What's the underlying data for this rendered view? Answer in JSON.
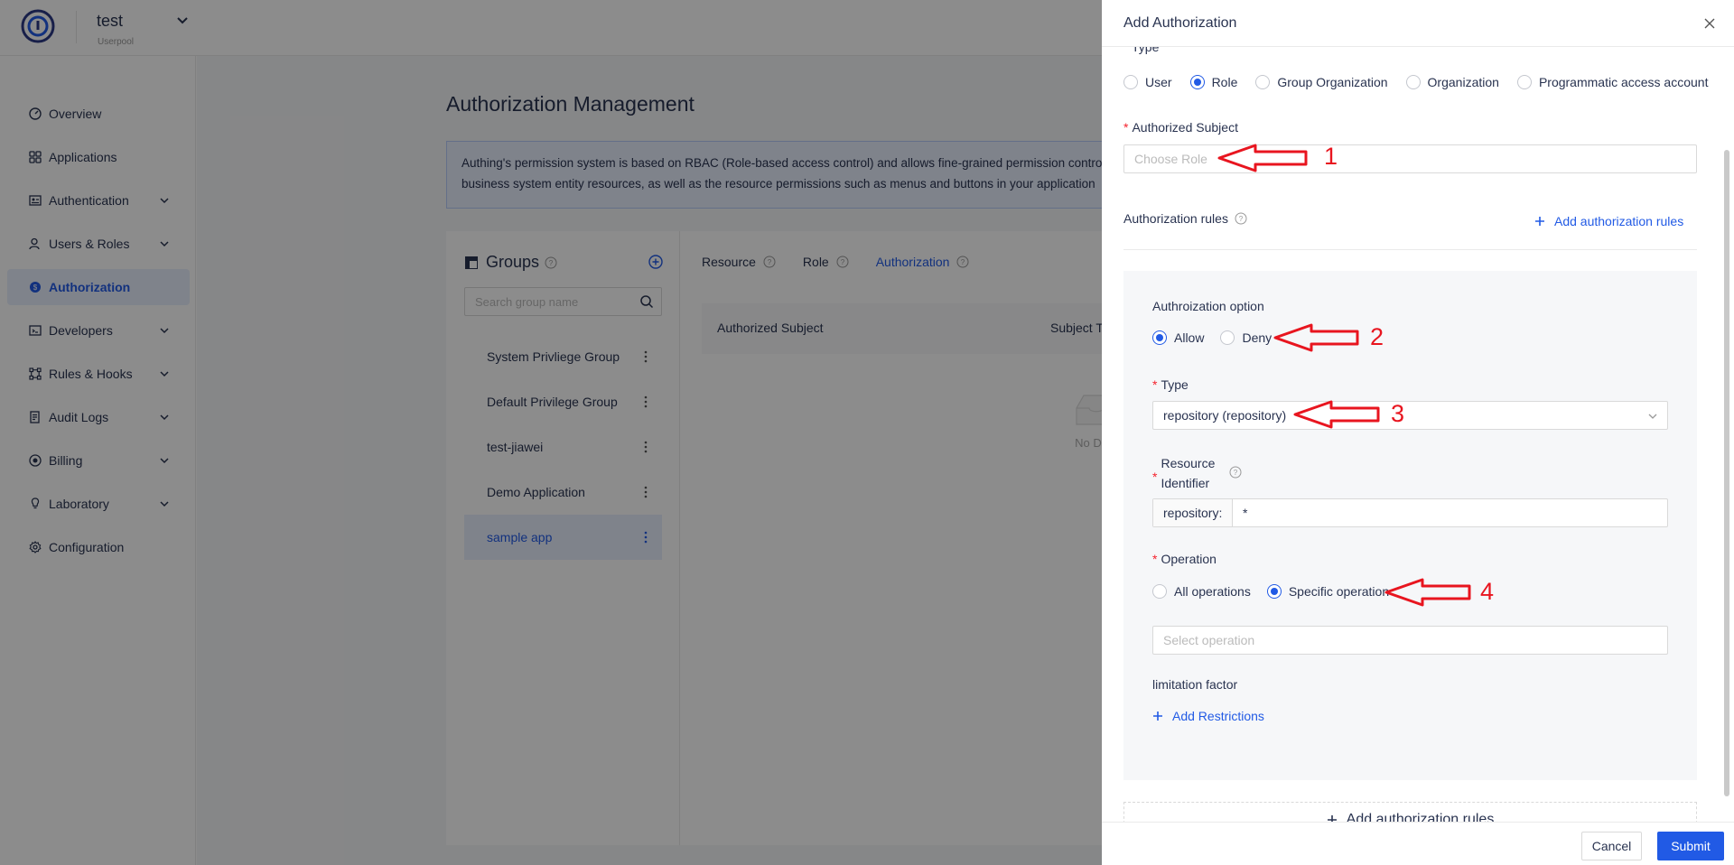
{
  "header": {
    "app_name": "test",
    "app_subtitle": "Userpool"
  },
  "sidebar": {
    "items": [
      {
        "label": "Overview",
        "icon": "dashboard-icon",
        "expandable": false,
        "active": false
      },
      {
        "label": "Applications",
        "icon": "apps-grid-icon",
        "expandable": false,
        "active": false
      },
      {
        "label": "Authentication",
        "icon": "id-card-icon",
        "expandable": true,
        "active": false
      },
      {
        "label": "Users & Roles",
        "icon": "user-icon",
        "expandable": true,
        "active": false
      },
      {
        "label": "Authorization",
        "icon": "authorization-icon",
        "expandable": false,
        "active": true
      },
      {
        "label": "Developers",
        "icon": "code-icon",
        "expandable": true,
        "active": false
      },
      {
        "label": "Rules & Hooks",
        "icon": "hooks-icon",
        "expandable": true,
        "active": false
      },
      {
        "label": "Audit Logs",
        "icon": "log-icon",
        "expandable": true,
        "active": false
      },
      {
        "label": "Billing",
        "icon": "billing-icon",
        "expandable": true,
        "active": false
      },
      {
        "label": "Laboratory",
        "icon": "bulb-icon",
        "expandable": true,
        "active": false
      },
      {
        "label": "Configuration",
        "icon": "gear-icon",
        "expandable": false,
        "active": false
      }
    ]
  },
  "main": {
    "title": "Authorization Management",
    "info_line1": "Authing's permission system is based on RBAC (Role-based access control) and allows fine-grained permission contro",
    "info_line2": "business system entity resources, as well as the resource permissions such as menus and buttons in your application",
    "groups": {
      "title": "Groups",
      "search_placeholder": "Search group name",
      "items": [
        {
          "label": "System Privliege Group",
          "selected": false
        },
        {
          "label": "Default Privilege Group",
          "selected": false
        },
        {
          "label": "test-jiawei",
          "selected": false
        },
        {
          "label": "Demo Application",
          "selected": false
        },
        {
          "label": "sample app",
          "selected": true
        }
      ]
    },
    "tabs": [
      {
        "label": "Resource",
        "active": false
      },
      {
        "label": "Role",
        "active": false
      },
      {
        "label": "Authorization",
        "active": true
      }
    ],
    "table": {
      "columns": [
        "Authorized Subject",
        "Subject Ty"
      ],
      "empty_text": "No Data"
    }
  },
  "drawer": {
    "title": "Add Authorization",
    "type_label": "Type",
    "type_options": [
      {
        "label": "User",
        "checked": false
      },
      {
        "label": "Role",
        "checked": true
      },
      {
        "label": "Group Organization",
        "checked": false
      },
      {
        "label": "Organization",
        "checked": false
      },
      {
        "label": "Programmatic access account",
        "checked": false
      }
    ],
    "subject_label": "Authorized Subject",
    "subject_placeholder": "Choose Role",
    "rules_label": "Authorization rules",
    "add_rules_link": "Add authorization rules",
    "rule": {
      "option_label": "Authroization option",
      "options": [
        {
          "label": "Allow",
          "checked": true
        },
        {
          "label": "Deny",
          "checked": false
        }
      ],
      "type_label": "Type",
      "type_value": "repository (repository)",
      "resource_label_line1": "Resource",
      "resource_label_line2": "Identifier",
      "resource_prefix": "repository:",
      "resource_value": "*",
      "operation_label": "Operation",
      "operation_options": [
        {
          "label": "All operations",
          "checked": false
        },
        {
          "label": "Specific operation",
          "checked": true
        }
      ],
      "operation_placeholder": "Select operation",
      "limitation_label": "limitation factor",
      "add_restrictions": "Add Restrictions"
    },
    "add_rules_button": "Add authorization rules",
    "cancel": "Cancel",
    "submit": "Submit"
  },
  "annotations": [
    "1",
    "2",
    "3",
    "4"
  ],
  "colors": {
    "accent": "#215ae5",
    "annotation_red": "#e8151f",
    "required": "#f5222d",
    "overlay": "rgba(0,0,0,0.45)"
  }
}
